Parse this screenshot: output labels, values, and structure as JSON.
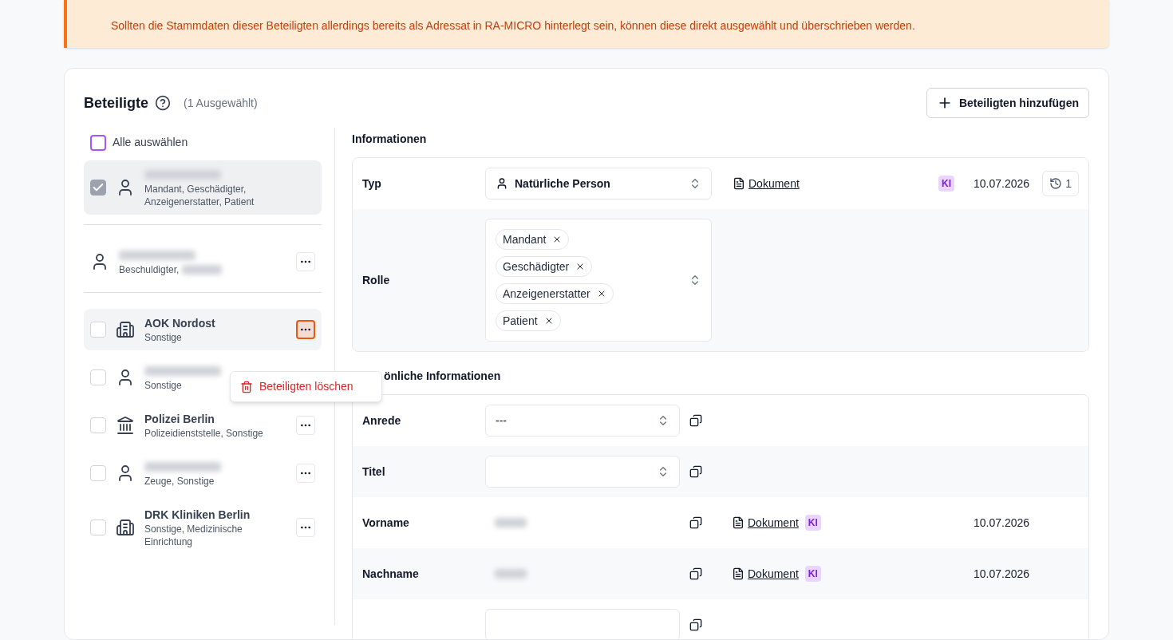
{
  "notice": {
    "text": "Sollten die Stammdaten dieser Beteiligten allerdings bereits als Adressat in RA-MICRO hinterlegt sein, können diese direkt ausgewählt und überschrieben werden."
  },
  "header": {
    "title": "Beteiligte",
    "selection_count": "(1 Ausgewählt)",
    "add_button": "Beteiligten hinzufügen"
  },
  "select_all": {
    "label": "Alle auswählen",
    "checked": false
  },
  "participants": [
    {
      "kind": "person",
      "selectable": true,
      "roles": "Mandant, Geschädigter, Anzeigenerstatter, Patient",
      "checked": true,
      "selected": true,
      "has_menu": false,
      "menu_open": false,
      "divider_after": true
    },
    {
      "kind": "person",
      "selectable": false,
      "roles": "Beschuldigter,",
      "roles_redacted": true,
      "selected": false,
      "has_menu": true,
      "menu_open": false,
      "divider_after": true
    },
    {
      "kind": "organization",
      "selectable": true,
      "name": "AOK Nordost",
      "roles": "Sonstige",
      "checked": false,
      "selected": true,
      "has_menu": true,
      "menu_open": true,
      "divider_after": false
    },
    {
      "kind": "person",
      "selectable": true,
      "roles": "Sonstige",
      "checked": false,
      "selected": false,
      "has_menu": false,
      "menu_open": false,
      "divider_after": false
    },
    {
      "kind": "authority",
      "selectable": true,
      "name": "Polizei Berlin",
      "roles": "Polizeidienststelle, Sonstige",
      "checked": false,
      "selected": false,
      "has_menu": true,
      "menu_open": false,
      "divider_after": false
    },
    {
      "kind": "person",
      "selectable": true,
      "roles": "Zeuge, Sonstige",
      "checked": false,
      "selected": false,
      "has_menu": true,
      "menu_open": false,
      "divider_after": false
    },
    {
      "kind": "organization",
      "selectable": true,
      "name": "DRK Kliniken Berlin",
      "roles": "Sonstige, Medizinische Einrichtung",
      "checked": false,
      "selected": false,
      "has_menu": true,
      "menu_open": false,
      "divider_after": false
    }
  ],
  "context_menu": {
    "item": "Beteiligten löschen"
  },
  "sections": [
    {
      "title": "Informationen",
      "rows": [
        {
          "label": "Typ",
          "kind": "type-select",
          "value": "Natürliche Person",
          "copy": false,
          "source": "Dokument",
          "badge": "KI",
          "date": "10.07.2026",
          "history": "1"
        },
        {
          "label": "Rolle",
          "kind": "tags",
          "tags": [
            "Mandant",
            "Geschädigter",
            "Anzeigenerstatter",
            "Patient"
          ],
          "copy": false
        }
      ]
    },
    {
      "title": "önliche Informationen",
      "rows": [
        {
          "label": "Anrede",
          "kind": "select",
          "value": "---",
          "copy": true
        },
        {
          "label": "Titel",
          "kind": "select",
          "copy": true
        },
        {
          "label": "Vorname",
          "kind": "redacted",
          "copy": true,
          "source": "Dokument",
          "badge": "KI",
          "date": "10.07.2026"
        },
        {
          "label": "Nachname",
          "kind": "redacted",
          "copy": true,
          "source": "Dokument",
          "badge": "KI",
          "date": "10.07.2026"
        },
        {
          "kind": "input",
          "copy": true
        }
      ]
    }
  ]
}
